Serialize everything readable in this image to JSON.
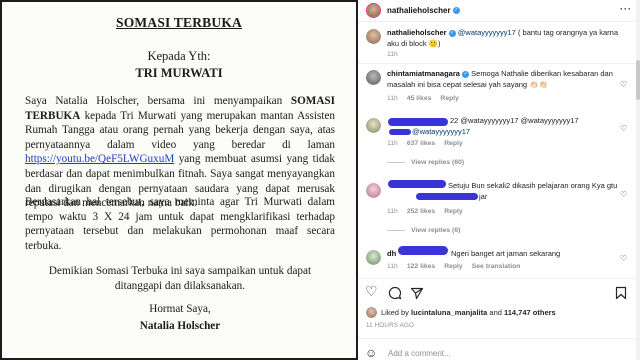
{
  "document": {
    "title": "SOMASI TERBUKA",
    "to_label": "Kepada Yth:",
    "recipient": "TRI MURWATI",
    "p1_a": "Saya Natalia Holscher, bersama ini menyampaikan ",
    "p1_bold1": "SOMASI TERBUKA",
    "p1_b": " kepada Tri Murwati yang merupakan mantan Assisten Rumah Tangga atau orang pernah yang bekerja dengan saya, atas pernyataannya dalam video yang beredar di laman ",
    "p1_link": "https://youtu.be/QeF5LWGuxuM",
    "p1_c": " yang membuat asumsi yang tidak berdasar dan dapat menimbulkan fitnah. Saya sangat menyayangkan dan dirugikan dengan pernyataan saudara yang dapat merusak reputasi dan mencemarkan nama baik.",
    "p2": "Berdasarkan hal tersebut, saya meminta agar Tri Murwati dalam tempo waktu 3 X 24 jam untuk dapat mengklarifikasi terhadap pernyataan tersebut dan melakukan permohonan maaf secara terbuka.",
    "closing": "Demikian Somasi Terbuka ini saya sampaikan untuk dapat ditanggapi dan dilaksanakan.",
    "regards": "Hormat Saya,",
    "signature": "Natalia Holscher"
  },
  "sidebar": {
    "post_author": "nathalieholscher",
    "post_author_verified": true,
    "reply": {
      "username": "nathalieholscher",
      "mention": "@watayyyyyyy17",
      "text": " ( bantu tag orangnya ya karna aku di block 🙂)",
      "age": "11h"
    },
    "comments": [
      {
        "username": "chintamiatmanagara",
        "text": "Semoga Nathalie diberikan kesabaran dan masalah ini bisa cepat selesai yah sayang 👏🏻👏🏻",
        "age": "11h",
        "likes": "45 likes",
        "reply_label": "Reply",
        "view_replies": null
      },
      {
        "username": "",
        "text_visible": "22 @watayyyyyyy17 @watayyyyyyy17",
        "text_line2": "@watayyyyyyy17",
        "age": "11h",
        "likes": "637 likes",
        "reply_label": "Reply",
        "view_replies": "View replies (60)"
      },
      {
        "username": "",
        "text_visible": "Setuju Bun sekali2 dikasih pelajaran orang Kya gtu",
        "text_line2": "jar",
        "age": "11h",
        "likes": "252 likes",
        "reply_label": "Reply",
        "view_replies": "View replies (6)"
      },
      {
        "username": "dh",
        "text_visible": "Ngeri banget art jaman sekarang",
        "age": "11h",
        "likes": "122 likes",
        "reply_label": "Reply",
        "translation": "See translation"
      }
    ],
    "liked_by_prefix": "Liked by ",
    "liked_by_user": "lucintaluna_manjalita",
    "liked_by_mid": " and ",
    "liked_by_count": "114,747 others",
    "time_ago": "11 HOURS AGO",
    "comment_placeholder": "Add a comment..."
  },
  "colors": {
    "verified_blue": "#3897f0",
    "link_blue": "#1a3fc4",
    "redaction": "#3a34d8"
  }
}
